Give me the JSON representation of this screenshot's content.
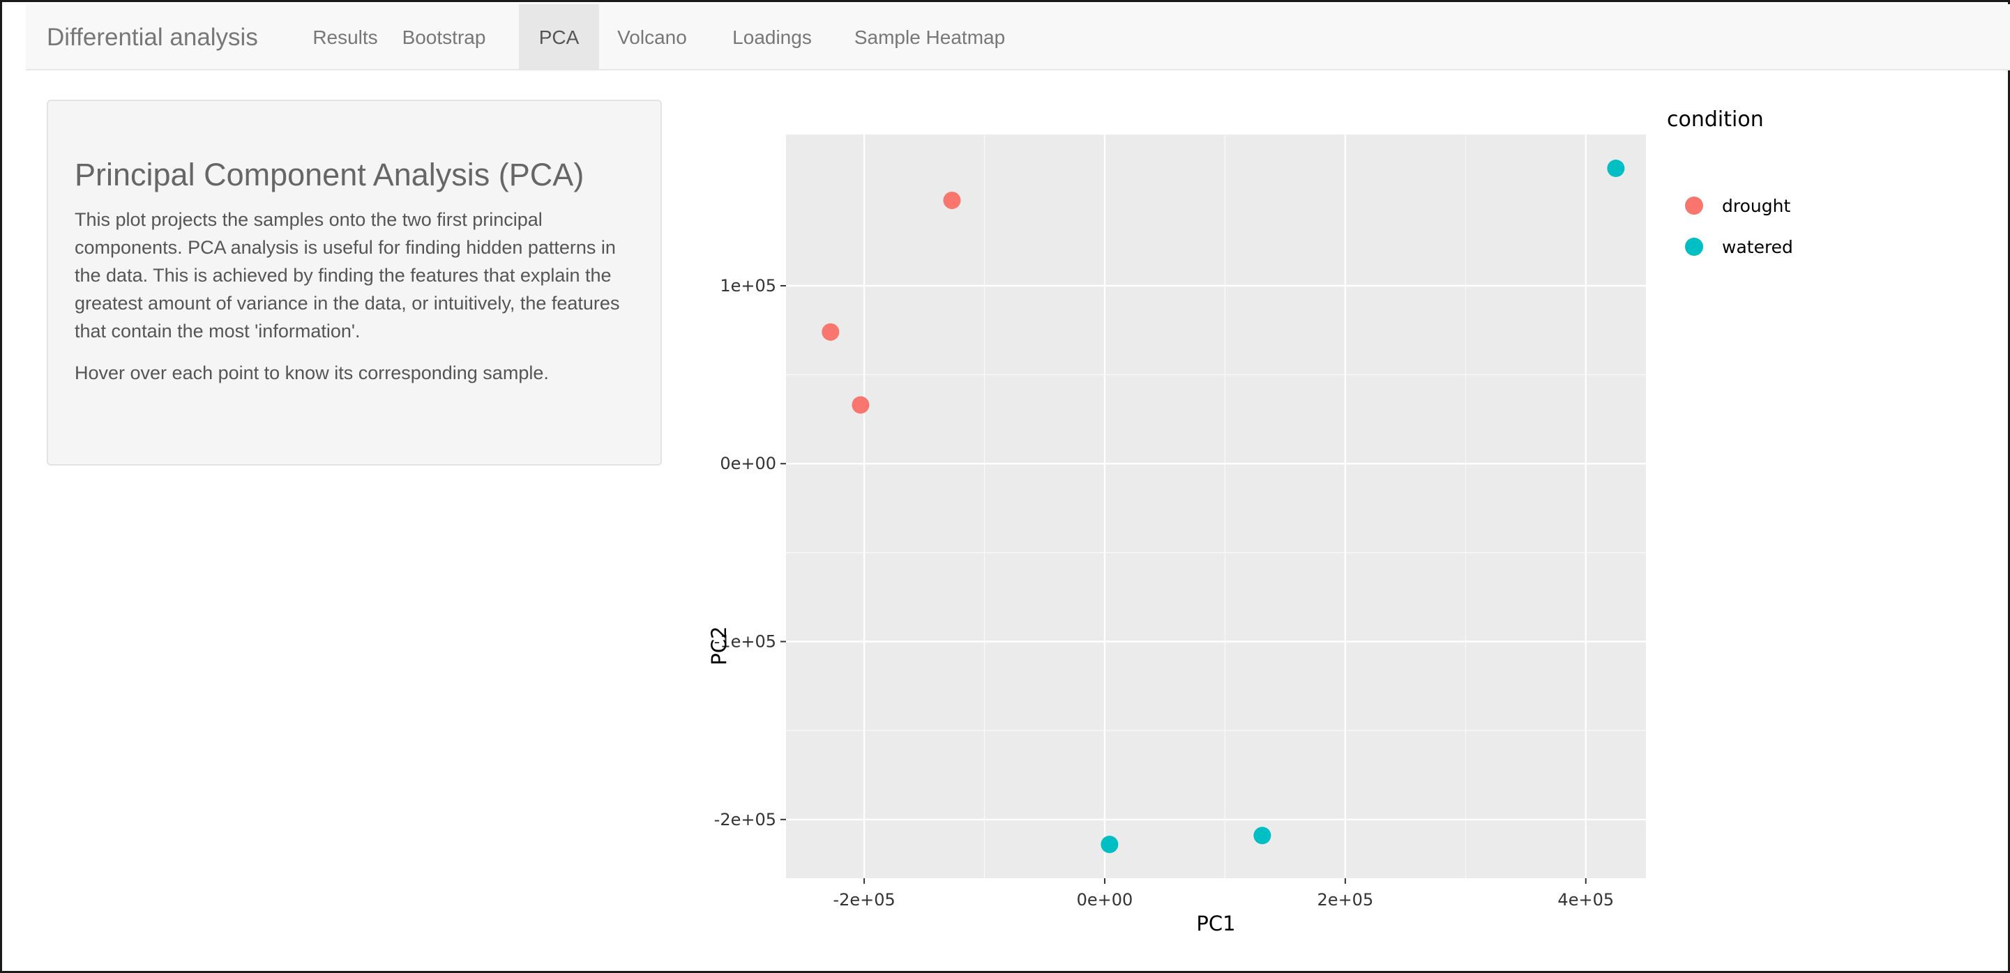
{
  "navbar": {
    "brand": "Differential analysis",
    "tabs": [
      {
        "label": "Results",
        "active": false
      },
      {
        "label": "Bootstrap",
        "active": false
      },
      {
        "label": "PCA",
        "active": true
      },
      {
        "label": "Volcano",
        "active": false
      },
      {
        "label": "Loadings",
        "active": false
      },
      {
        "label": "Sample Heatmap",
        "active": false
      }
    ]
  },
  "sidebar": {
    "title": "Principal Component Analysis (PCA)",
    "description": "This plot projects the samples onto the two first principal components. PCA analysis is useful for finding hidden patterns in the data. This is achieved by finding the features that explain the greatest amount of variance in the data, or intuitively, the features that contain the most 'information'.",
    "hint": "Hover over each point to know its corresponding sample."
  },
  "colors": {
    "drought": "#F8766D",
    "watered": "#00BFC4",
    "panel_bg": "#EBEBEB",
    "grid": "#FFFFFF"
  },
  "chart_data": {
    "type": "scatter",
    "title": "",
    "xlabel": "PC1",
    "ylabel": "PC2",
    "xlim": [
      -265000,
      450000
    ],
    "ylim": [
      -233000,
      185000
    ],
    "xticks": [
      {
        "value": -200000,
        "label": "-2e+05"
      },
      {
        "value": 0,
        "label": "0e+00"
      },
      {
        "value": 200000,
        "label": "2e+05"
      },
      {
        "value": 400000,
        "label": "4e+05"
      }
    ],
    "yticks": [
      {
        "value": 100000,
        "label": "1e+05"
      },
      {
        "value": 0,
        "label": "0e+00"
      },
      {
        "value": -100000,
        "label": "-1e+05"
      },
      {
        "value": -200000,
        "label": "-2e+05"
      }
    ],
    "grid": true,
    "legend": {
      "title": "condition",
      "position": "right"
    },
    "series": [
      {
        "name": "drought",
        "points": [
          {
            "x": -127000,
            "y": 148000
          },
          {
            "x": -228000,
            "y": 74000
          },
          {
            "x": -203000,
            "y": 33000
          }
        ]
      },
      {
        "name": "watered",
        "points": [
          {
            "x": 425000,
            "y": 166000
          },
          {
            "x": 4000,
            "y": -214000
          },
          {
            "x": 131000,
            "y": -209000
          }
        ]
      }
    ]
  }
}
